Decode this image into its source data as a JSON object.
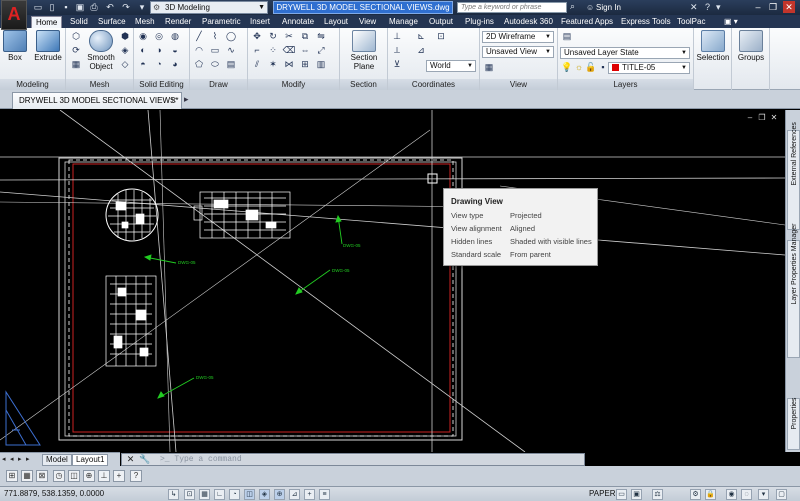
{
  "titlebar": {
    "logo": "A",
    "workspace": "3D Modeling",
    "document_title": "DRYWELL 3D MODEL SECTIONAL VIEWS.dwg",
    "search_placeholder": "Type a keyword or phrase",
    "sign_in": "Sign In"
  },
  "ribbon_tabs": [
    "Home",
    "Solid",
    "Surface",
    "Mesh",
    "Render",
    "Parametric",
    "Insert",
    "Annotate",
    "Layout",
    "View",
    "Manage",
    "Output",
    "Plug-ins",
    "Autodesk 360",
    "Featured Apps",
    "Express Tools",
    "ToolPac"
  ],
  "active_tab": "Home",
  "ribbon": {
    "modeling": {
      "title": "Modeling",
      "box": "Box",
      "extrude": "Extrude"
    },
    "mesh": {
      "title": "Mesh",
      "smooth_object_1": "Smooth",
      "smooth_object_2": "Object"
    },
    "solid_editing": {
      "title": "Solid Editing"
    },
    "draw": {
      "title": "Draw"
    },
    "modify": {
      "title": "Modify"
    },
    "section": {
      "title": "Section",
      "section_plane_1": "Section",
      "section_plane_2": "Plane"
    },
    "coordinates": {
      "title": "Coordinates",
      "ucs": "World"
    },
    "view": {
      "title": "View",
      "visual_style": "2D Wireframe",
      "named_view": "Unsaved View"
    },
    "layers": {
      "title": "Layers",
      "layer_state": "Unsaved Layer State",
      "current_layer": "TITLE-05",
      "layer_color": "#dd0000"
    },
    "selection": {
      "label": "Selection"
    },
    "groups": {
      "label": "Groups"
    }
  },
  "doc_tab": {
    "label": "DRYWELL 3D MODEL SECTIONAL VIEWS*"
  },
  "canvas": {
    "background": "#000000",
    "annotation_color": "#22cc22",
    "labels": [
      "DWG-05",
      "DWG-05",
      "DWG-05",
      "DWG-05"
    ]
  },
  "side_palettes": [
    "External References",
    "Layer Properties Manager",
    "Properties"
  ],
  "tooltip": {
    "title": "Drawing View",
    "rows": [
      {
        "key": "View type",
        "value": "Projected"
      },
      {
        "key": "View alignment",
        "value": "Aligned"
      },
      {
        "key": "Hidden lines",
        "value": "Shaded with visible lines"
      },
      {
        "key": "Standard scale",
        "value": "From parent"
      }
    ]
  },
  "layout_tabs": [
    "Model",
    "Layout1"
  ],
  "command_line": {
    "placeholder": "Type a command"
  },
  "statusbar": {
    "coordinates": "771.8879, 538.1359, 0.0000",
    "space": "PAPER"
  }
}
